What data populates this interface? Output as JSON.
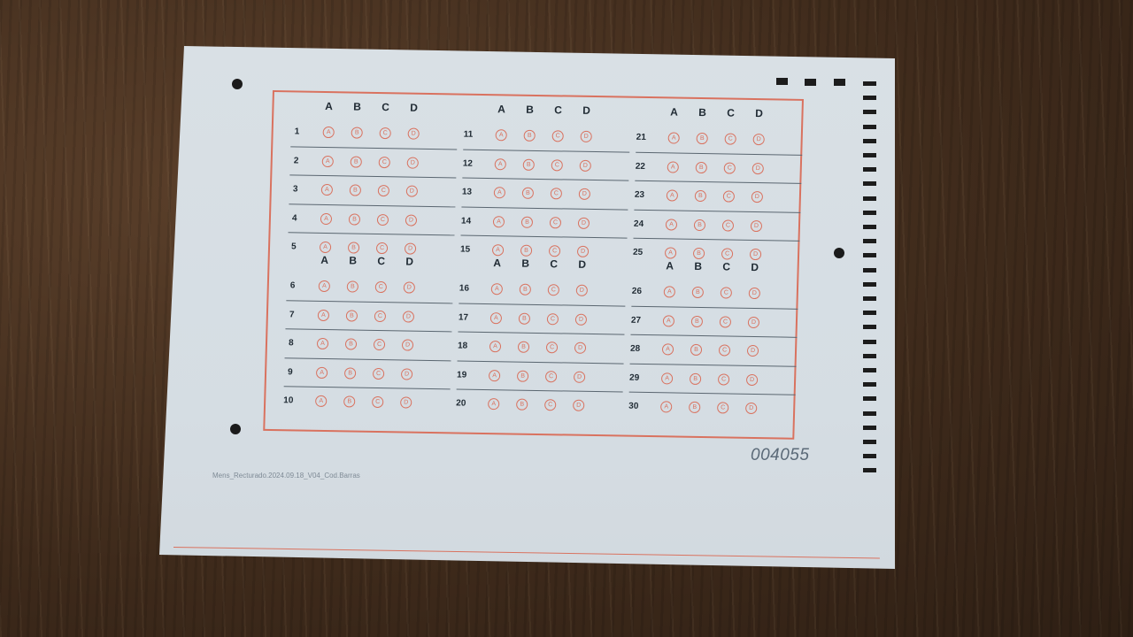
{
  "sheet": {
    "serial": "004055",
    "footer_text": "Mens_Recturado.2024.09.18_V04_Cod.Barras",
    "options": [
      "A",
      "B",
      "C",
      "D"
    ],
    "blocks": [
      {
        "numbers": [
          "1",
          "2",
          "3",
          "4",
          "5"
        ]
      },
      {
        "numbers": [
          "11",
          "12",
          "13",
          "14",
          "15"
        ]
      },
      {
        "numbers": [
          "21",
          "22",
          "23",
          "24",
          "25"
        ]
      },
      {
        "numbers": [
          "6",
          "7",
          "8",
          "9",
          "10"
        ]
      },
      {
        "numbers": [
          "16",
          "17",
          "18",
          "19",
          "20"
        ]
      },
      {
        "numbers": [
          "26",
          "27",
          "28",
          "29",
          "30"
        ]
      }
    ]
  }
}
